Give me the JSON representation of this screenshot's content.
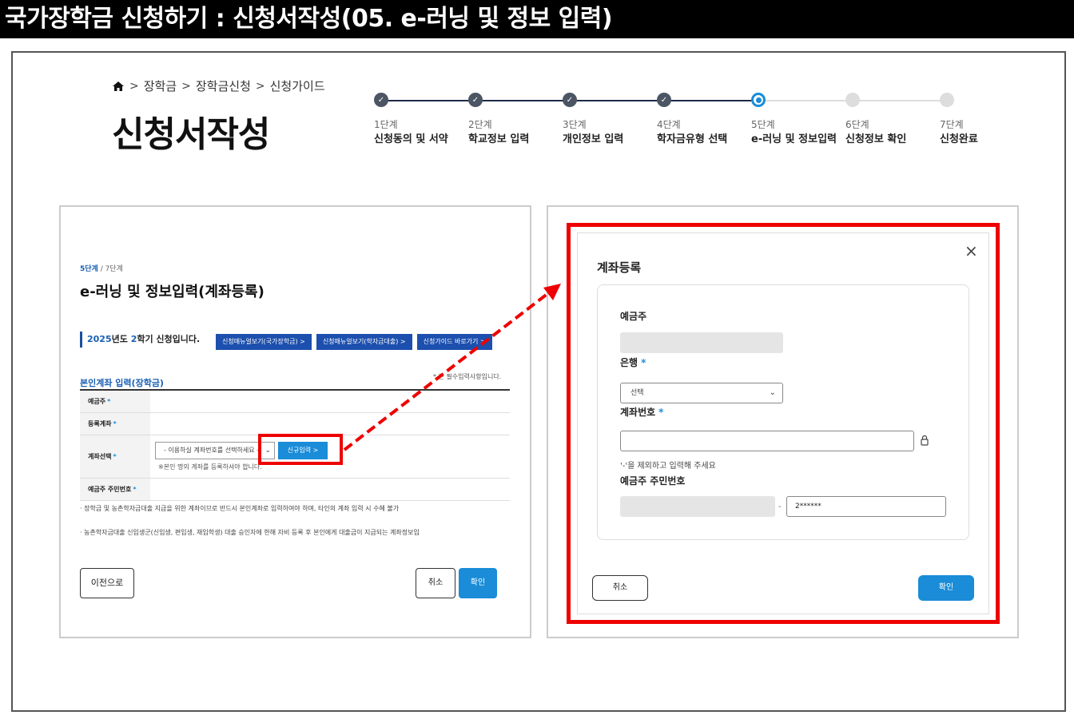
{
  "page_title": "국가장학금 신청하기 : 신청서작성(05. e-러닝 및 정보 입력)",
  "breadcrumb": {
    "items": [
      "장학금",
      "장학금신청",
      "신청가이드"
    ]
  },
  "header_title": "신청서작성",
  "steps": [
    {
      "num": "1단계",
      "name": "신청동의 및 서약",
      "status": "done"
    },
    {
      "num": "2단계",
      "name": "학교정보 입력",
      "status": "done"
    },
    {
      "num": "3단계",
      "name": "개인정보 입력",
      "status": "done"
    },
    {
      "num": "4단계",
      "name": "학자금유형 선택",
      "status": "done"
    },
    {
      "num": "5단계",
      "name": "e-러닝 및 정보입력",
      "status": "current"
    },
    {
      "num": "6단계",
      "name": "신청정보 확인",
      "status": "todo"
    },
    {
      "num": "7단계",
      "name": "신청완료",
      "status": "todo"
    }
  ],
  "left": {
    "step_current": "5단계",
    "step_total": " / 7단계",
    "title": "e-러닝 및 정보입력(계좌등록)",
    "semester_year": "2025",
    "semester_mid": "년도 ",
    "semester_num": "2",
    "semester_end": "학기 신청입니다.",
    "buttons": [
      "신청매뉴얼보기(국가장학금)  >",
      "신청매뉴얼보기(학자금대출)  >",
      "신청가이드 바로가기  >"
    ],
    "required_note": "* 는 필수입력사항입니다.",
    "section": "본인계좌 입력(장학금)",
    "rows": [
      "예금주",
      "등록계좌",
      "계좌선택",
      "예금주 주민번호"
    ],
    "select_placeholder": "- 이용하실 계좌번호를 선택하세요 -",
    "new_button": "신규입력  >",
    "select_note": "※본인 명의 계좌를 등록하셔야 합니다.",
    "bullet1": "· 장학금 및 농촌학자금대출 지급을 위한 계좌이므로 반드시 본인계좌로 입력하여야 하며, 타인의 계좌 입력 시 수혜 불가",
    "bullet2": "· 농촌학자금대출 신입생군(신입생, 편입생, 재입학생) 대출 승인자에 한해 자비 등록 후 본인에게 대출금이 지급되는 계좌정보입",
    "prev_button": "이전으로",
    "cancel_button": "취소",
    "ok_button": "확인"
  },
  "modal": {
    "title": "계좌등록",
    "holder_label": "예금주",
    "bank_label": "은행",
    "bank_select": "선택",
    "account_label": "계좌번호",
    "account_hint": "'-'을 제외하고 입력해 주세요",
    "rrn_label": "예금주 주민번호",
    "rrn_dash": "-",
    "rrn_back": "2******",
    "cancel_button": "취소",
    "ok_button": "확인"
  },
  "colors": {
    "accent": "#1a8cd8",
    "highlight": "#e00000",
    "done_step": "#4b5563"
  }
}
